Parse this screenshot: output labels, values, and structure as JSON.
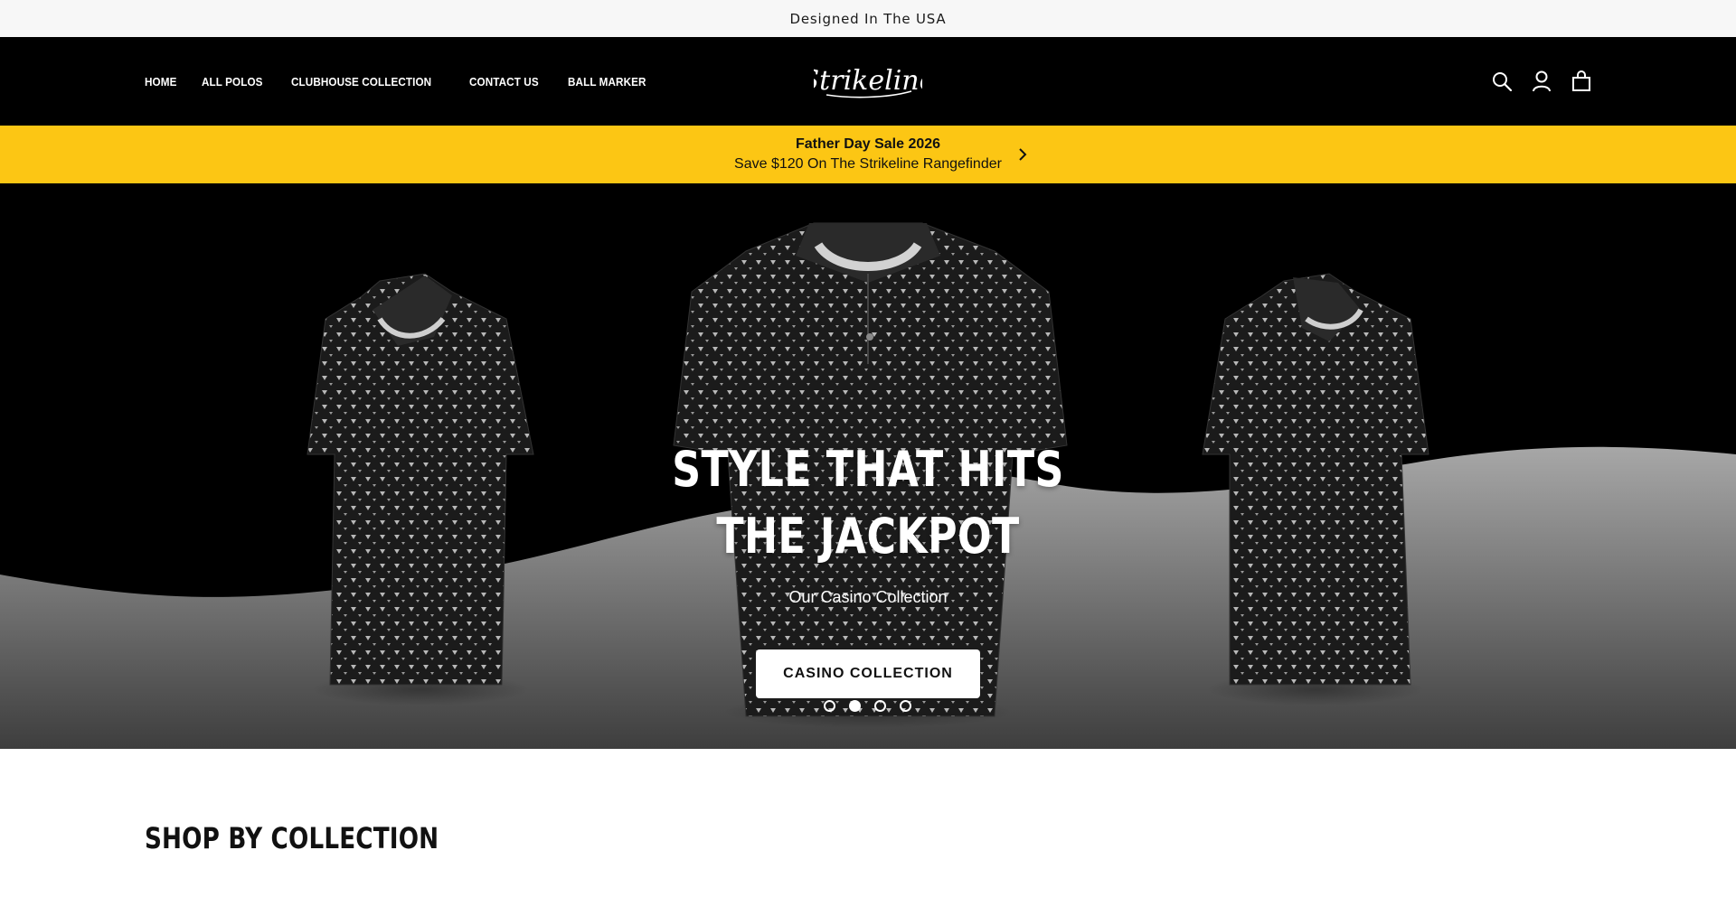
{
  "announcement": {
    "text": "Designed In The USA"
  },
  "header": {
    "nav": [
      {
        "label": "HOME"
      },
      {
        "label": "ALL POLOS"
      },
      {
        "label": "CLUBHOUSE COLLECTION"
      },
      {
        "label": "CONTACT US"
      },
      {
        "label": "BALL MARKER"
      }
    ],
    "logo_text": "Strikeline",
    "icons": [
      "search-icon",
      "account-icon",
      "cart-icon"
    ]
  },
  "promo": {
    "title": "Father Day Sale 2026",
    "subtitle": "Save $120 On The Strikeline Rangefinder",
    "icon": "chevron-right-icon"
  },
  "hero": {
    "title_line1": "STYLE THAT HITS",
    "title_line2": "THE JACKPOT",
    "subtitle": "Our Casino Collection",
    "button_label": "CASINO COLLECTION",
    "slides_count": 4,
    "active_slide": 2
  },
  "section": {
    "title": "SHOP BY COLLECTION"
  },
  "colors": {
    "promo_bg": "#fcc614",
    "header_bg": "#000000",
    "topbar_bg": "#f7f7f7"
  }
}
